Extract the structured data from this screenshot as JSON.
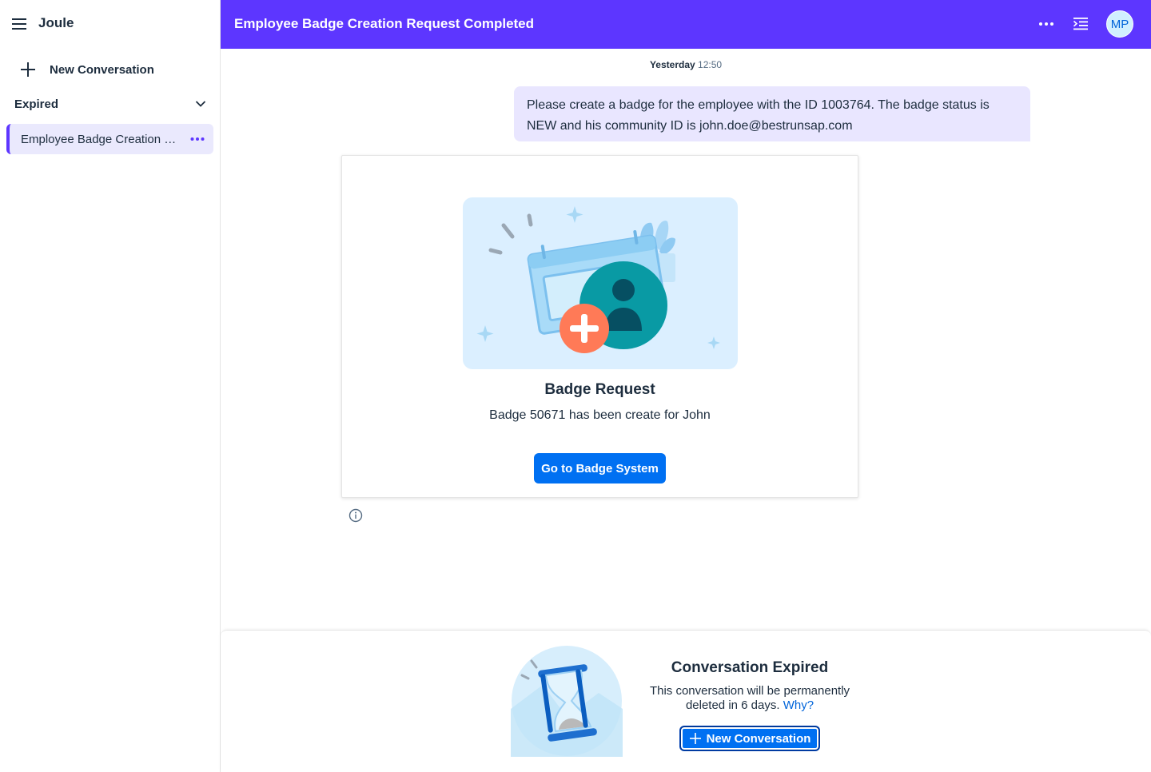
{
  "sidebar": {
    "app_name": "Joule",
    "new_conversation_label": "New Conversation",
    "section_label": "Expired",
    "conversations": [
      {
        "label": "Employee Badge Creation R..."
      }
    ]
  },
  "header": {
    "title": "Employee Badge Creation Request Completed",
    "avatar_initials": "MP"
  },
  "chat": {
    "timestamp_day": "Yesterday",
    "timestamp_time": "12:50",
    "user_message": "Please create a badge for the employee with the ID 1003764. The badge status is NEW and his community ID is john.doe@bestrunsap.com",
    "card": {
      "title": "Badge Request",
      "subtitle": "Badge 50671 has been create for John",
      "button_label": "Go to Badge System"
    }
  },
  "expired_panel": {
    "title": "Conversation Expired",
    "text": "This conversation will be permanently deleted in 6 days.",
    "link": "Why?",
    "button_label": "New Conversation"
  },
  "colors": {
    "brand": "#5d36ff",
    "accent": "#0070f2",
    "bubble": "#e9e6ff",
    "selected_item": "#eae9fd"
  },
  "icons": [
    "hamburger-icon",
    "plus-icon",
    "chevron-down-icon",
    "more-icon",
    "outdent-icon",
    "info-icon",
    "hourglass-illustration",
    "badge-illustration"
  ]
}
